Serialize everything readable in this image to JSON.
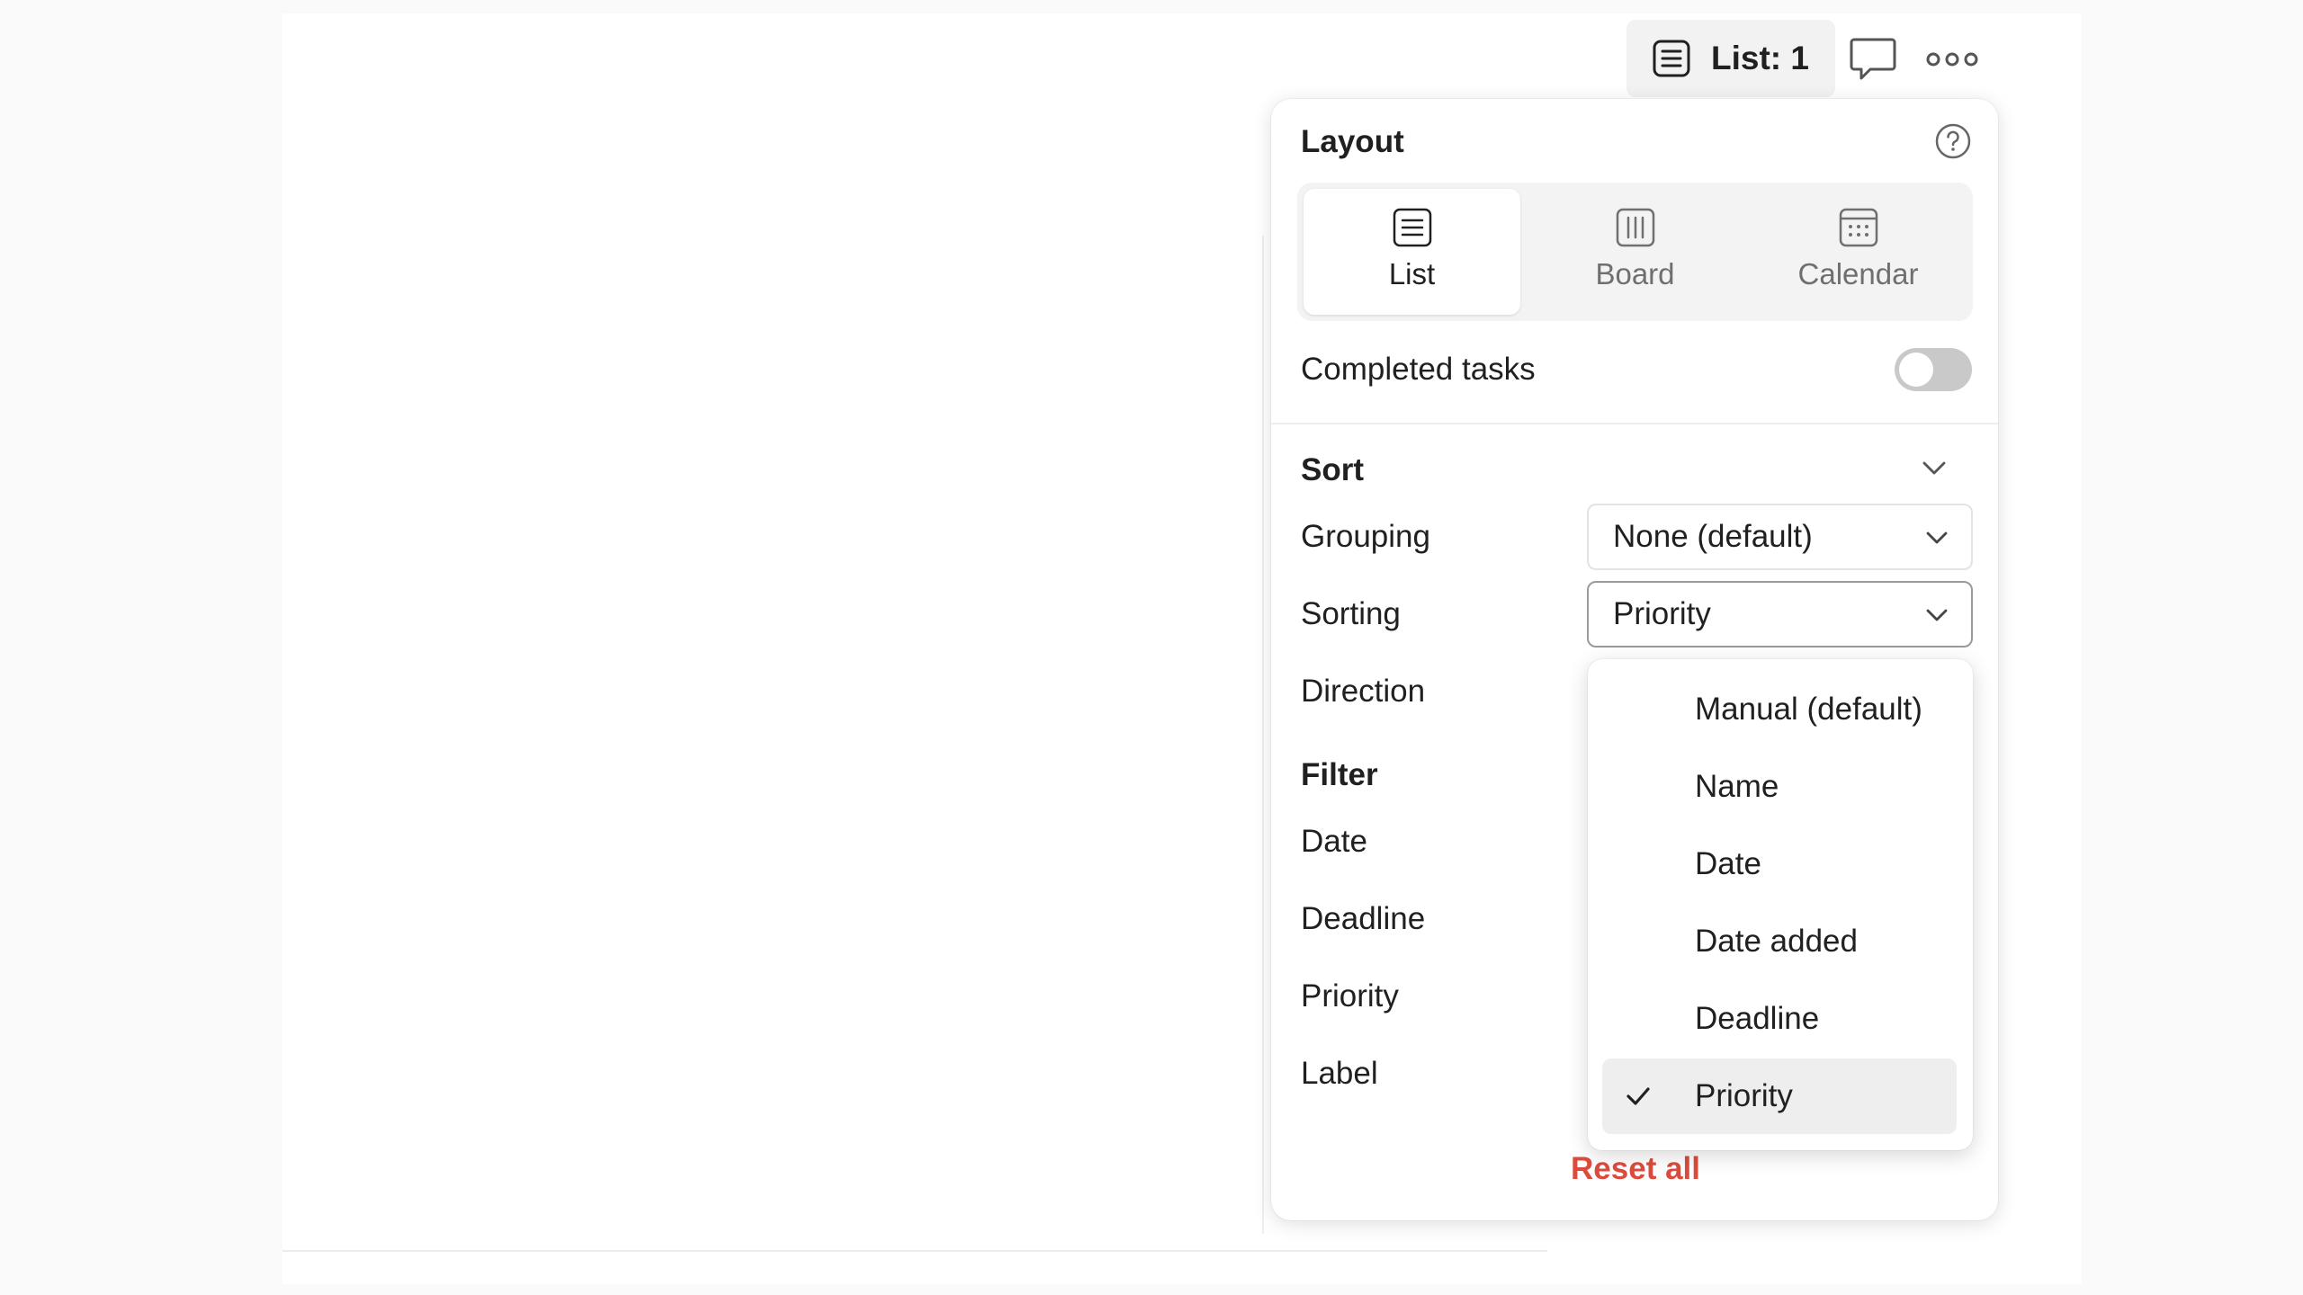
{
  "topbar": {
    "view_label": "List: 1",
    "view_icon": "list-icon",
    "comment_icon": "comment-icon",
    "more_icon": "more-horizontal-icon"
  },
  "panel": {
    "title": "Layout",
    "help_icon": "help-icon",
    "layouts": [
      {
        "label": "List",
        "icon": "list-icon",
        "selected": true
      },
      {
        "label": "Board",
        "icon": "board-icon",
        "selected": false
      },
      {
        "label": "Calendar",
        "icon": "calendar-icon",
        "selected": false
      }
    ],
    "completed_tasks": {
      "label": "Completed tasks",
      "enabled": false
    },
    "sort": {
      "title": "Sort",
      "grouping": {
        "label": "Grouping",
        "value": "None (default)"
      },
      "sorting": {
        "label": "Sorting",
        "value": "Priority"
      },
      "direction": {
        "label": "Direction"
      }
    },
    "filter": {
      "title": "Filter",
      "date": "Date",
      "deadline": "Deadline",
      "priority": "Priority",
      "label": "Label"
    },
    "reset_all": "Reset all"
  },
  "sorting_menu": {
    "options": [
      "Manual (default)",
      "Name",
      "Date",
      "Date added",
      "Deadline",
      "Priority"
    ],
    "selected": "Priority"
  },
  "colors": {
    "accent_red": "#dc4c3e",
    "toggle_off": "#c9c9c9",
    "selected_bg": "#eeeeee"
  }
}
